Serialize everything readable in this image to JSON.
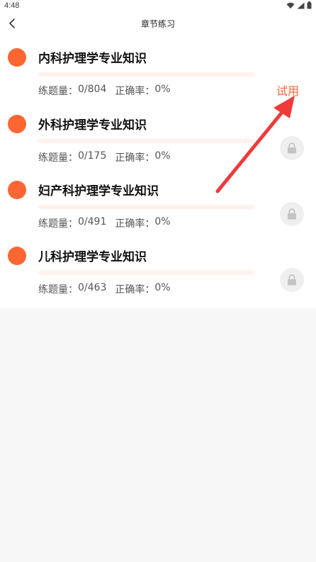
{
  "status_bar": {
    "time": "4:48",
    "icons": [
      "wifi-icon",
      "signal-icon",
      "battery-icon"
    ]
  },
  "app_bar": {
    "title": "章节练习",
    "back_icon": "chevron-left-icon"
  },
  "chapters": [
    {
      "title": "内科护理学专业知识",
      "count_label": "练题量：",
      "count_value": "0/804",
      "accuracy_label": "正确率：",
      "accuracy_value": "0%",
      "progress": 0,
      "action": "试用",
      "locked": false
    },
    {
      "title": "外科护理学专业知识",
      "count_label": "练题量：",
      "count_value": "0/175",
      "accuracy_label": "正确率：",
      "accuracy_value": "0%",
      "progress": 0,
      "locked": true
    },
    {
      "title": "妇产科护理学专业知识",
      "count_label": "练题量：",
      "count_value": "0/491",
      "accuracy_label": "正确率：",
      "accuracy_value": "0%",
      "progress": 0,
      "locked": true
    },
    {
      "title": "儿科护理学专业知识",
      "count_label": "练题量：",
      "count_value": "0/463",
      "accuracy_label": "正确率：",
      "accuracy_value": "0%",
      "progress": 0,
      "locked": true
    }
  ],
  "colors": {
    "accent": "#ff6632",
    "progress_track": "#fff1ee",
    "lock_bg": "#efefef",
    "arrow": "#f03a3a"
  }
}
